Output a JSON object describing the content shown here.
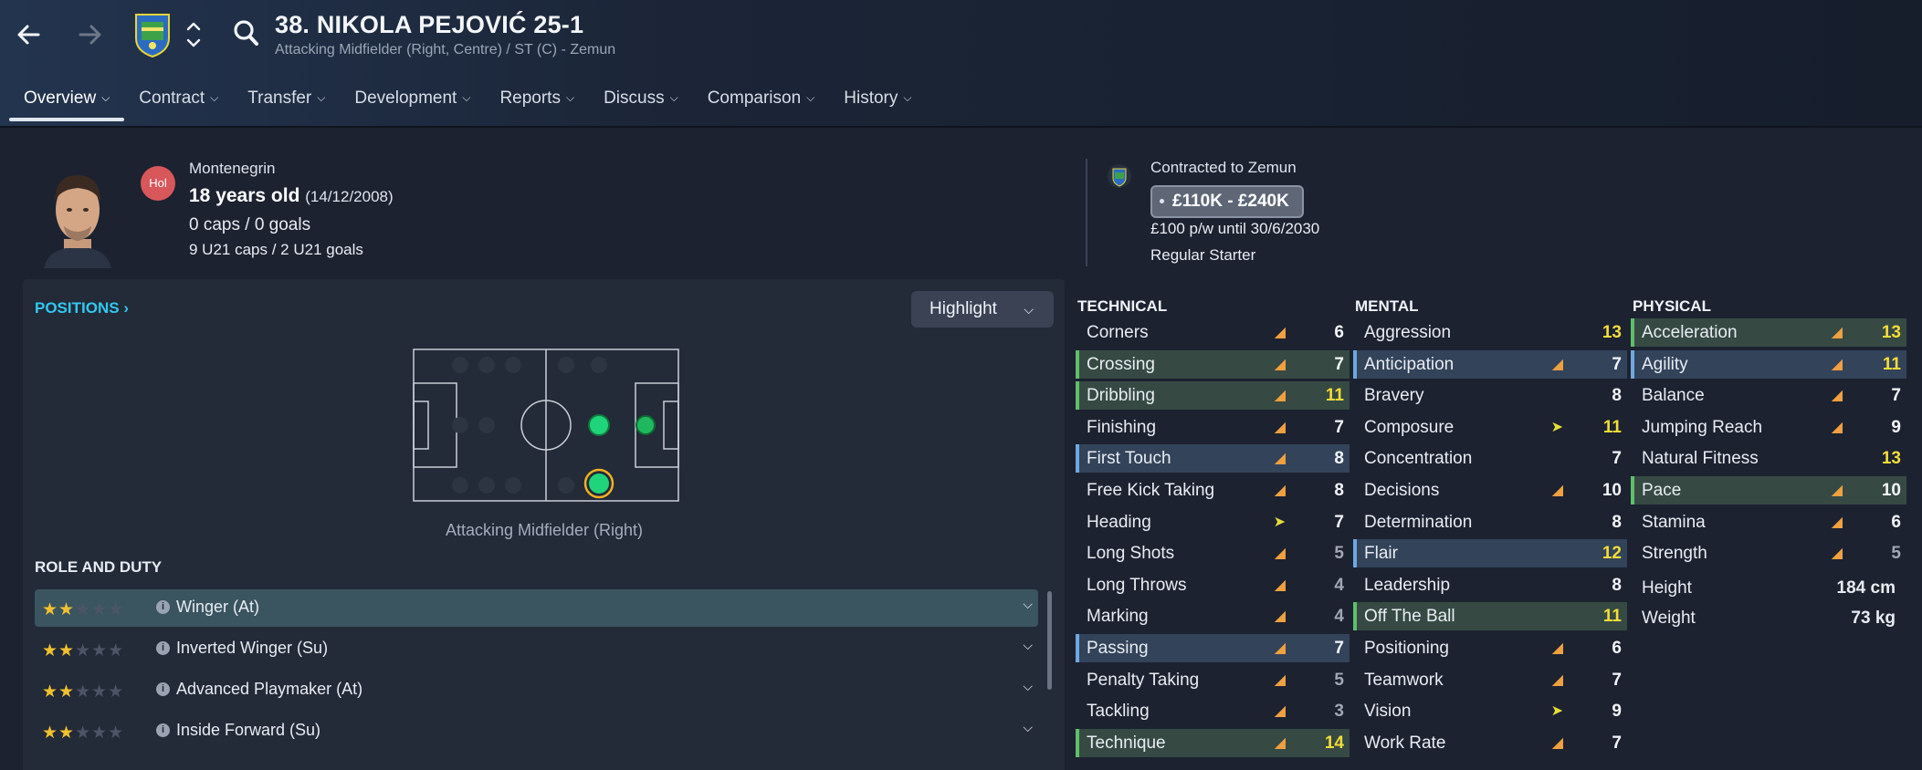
{
  "header": {
    "title": "38. NIKOLA PEJOVIĆ 25-1",
    "subtitle": "Attacking Midfielder (Right, Centre) / ST (C) - Zemun",
    "tabs": [
      {
        "label": "Overview"
      },
      {
        "label": "Contract"
      },
      {
        "label": "Transfer"
      },
      {
        "label": "Development"
      },
      {
        "label": "Reports"
      },
      {
        "label": "Discuss"
      },
      {
        "label": "Comparison"
      },
      {
        "label": "History"
      }
    ]
  },
  "summary": {
    "nationality": "Montenegrin",
    "badge": "Hol",
    "age": "18 years old",
    "dob": "(14/12/2008)",
    "caps": "0 caps / 0 goals",
    "u21": "9 U21 caps / 2 U21 goals",
    "contracted": "Contracted to Zemun",
    "value": "£110K - £240K",
    "wage": "£100 p/w until 30/6/2030",
    "status": "Regular Starter"
  },
  "positions": {
    "link_label": "POSITIONS",
    "highlight_label": "Highlight",
    "selected_position": "Attacking Midfielder (Right)"
  },
  "roles": {
    "heading": "ROLE AND DUTY",
    "items": [
      {
        "name": "Winger (At)",
        "stars": 2
      },
      {
        "name": "Inverted Winger (Su)",
        "stars": 2
      },
      {
        "name": "Advanced Playmaker (At)",
        "stars": 2
      },
      {
        "name": "Inside Forward (Su)",
        "stars": 2
      }
    ]
  },
  "attributes": {
    "technical_heading": "TECHNICAL",
    "mental_heading": "MENTAL",
    "physical_heading": "PHYSICAL",
    "technical": [
      {
        "name": "Corners",
        "value": "6"
      },
      {
        "name": "Crossing",
        "value": "7"
      },
      {
        "name": "Dribbling",
        "value": "11"
      },
      {
        "name": "Finishing",
        "value": "7"
      },
      {
        "name": "First Touch",
        "value": "8"
      },
      {
        "name": "Free Kick Taking",
        "value": "8"
      },
      {
        "name": "Heading",
        "value": "7"
      },
      {
        "name": "Long Shots",
        "value": "5"
      },
      {
        "name": "Long Throws",
        "value": "4"
      },
      {
        "name": "Marking",
        "value": "4"
      },
      {
        "name": "Passing",
        "value": "7"
      },
      {
        "name": "Penalty Taking",
        "value": "5"
      },
      {
        "name": "Tackling",
        "value": "3"
      },
      {
        "name": "Technique",
        "value": "14"
      }
    ],
    "mental": [
      {
        "name": "Aggression",
        "value": "13"
      },
      {
        "name": "Anticipation",
        "value": "7"
      },
      {
        "name": "Bravery",
        "value": "8"
      },
      {
        "name": "Composure",
        "value": "11"
      },
      {
        "name": "Concentration",
        "value": "7"
      },
      {
        "name": "Decisions",
        "value": "10"
      },
      {
        "name": "Determination",
        "value": "8"
      },
      {
        "name": "Flair",
        "value": "12"
      },
      {
        "name": "Leadership",
        "value": "8"
      },
      {
        "name": "Off The Ball",
        "value": "11"
      },
      {
        "name": "Positioning",
        "value": "6"
      },
      {
        "name": "Teamwork",
        "value": "7"
      },
      {
        "name": "Vision",
        "value": "9"
      },
      {
        "name": "Work Rate",
        "value": "7"
      }
    ],
    "physical": [
      {
        "name": "Acceleration",
        "value": "13"
      },
      {
        "name": "Agility",
        "value": "11"
      },
      {
        "name": "Balance",
        "value": "7"
      },
      {
        "name": "Jumping Reach",
        "value": "9"
      },
      {
        "name": "Natural Fitness",
        "value": "13"
      },
      {
        "name": "Pace",
        "value": "10"
      },
      {
        "name": "Stamina",
        "value": "6"
      },
      {
        "name": "Strength",
        "value": "5"
      }
    ],
    "height_label": "Height",
    "height_value": "184 cm",
    "weight_label": "Weight",
    "weight_value": "73 kg"
  }
}
